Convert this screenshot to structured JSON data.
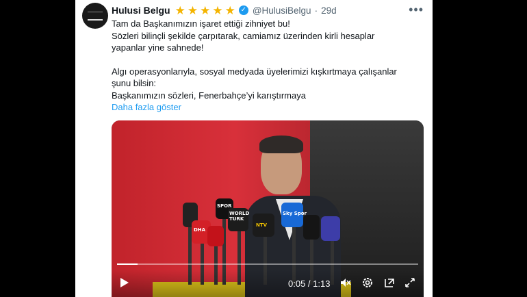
{
  "tweet": {
    "author_name": "Hulusi Belgu",
    "stars": [
      "★",
      "★",
      "★",
      "★",
      "★"
    ],
    "verified_glyph": "✓",
    "handle": "@HulusiBelgu",
    "separator": "·",
    "age": "29d",
    "more_label": "•••",
    "lines": [
      "Tam da Başkanımızın işaret ettiği zihniyet bu!",
      "Sözleri bilinçli şekilde çarpıtarak, camiamız üzerinden kirli hesaplar",
      "yapanlar yine sahnede!",
      "",
      "Algı operasyonlarıyla, sosyal medyada üyelerimizi kışkırtmaya çalışanlar",
      "şunu bilsin:",
      "Başkanımızın sözleri, Fenerbahçe’yi karıştırmaya"
    ],
    "show_more": "Daha fazla göster"
  },
  "video": {
    "current_time": "0:05",
    "duration": "1:13",
    "time_display": "0:05 / 1:13",
    "progress": 0.068,
    "mic_labels": [
      "SPOR",
      "DHA",
      "WORLD TURK",
      "NTV",
      "Sky Spor"
    ],
    "icons": [
      "play-icon",
      "mute-icon",
      "settings-icon",
      "pip-icon",
      "fullscreen-icon"
    ]
  },
  "colors": {
    "accent": "#1d9bf0",
    "star": "#f4b400",
    "text": "#0f1419",
    "muted": "#536471"
  }
}
